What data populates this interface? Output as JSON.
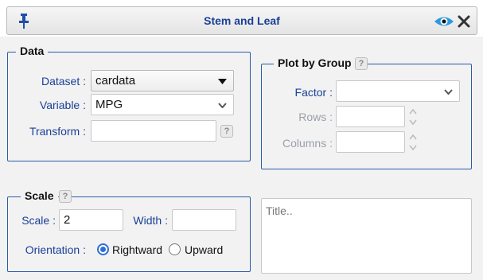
{
  "window": {
    "title": "Stem and Leaf"
  },
  "data_section": {
    "legend": "Data",
    "dataset_label": "Dataset :",
    "dataset_value": "cardata",
    "variable_label": "Variable :",
    "variable_value": "MPG",
    "transform_label": "Transform :",
    "transform_value": ""
  },
  "plot_by_group": {
    "legend": "Plot by Group",
    "factor_label": "Factor :",
    "factor_value": "",
    "rows_label": "Rows :",
    "columns_label": "Columns :"
  },
  "scale_section": {
    "legend": "Scale",
    "scale_label": "Scale :",
    "scale_value": "2",
    "width_label": "Width :",
    "width_value": "",
    "orientation_label": "Orientation :",
    "options": [
      "Rightward",
      "Upward"
    ],
    "selected": "Rightward"
  },
  "title_area": {
    "placeholder": "Title.."
  },
  "help_glyph": "?"
}
